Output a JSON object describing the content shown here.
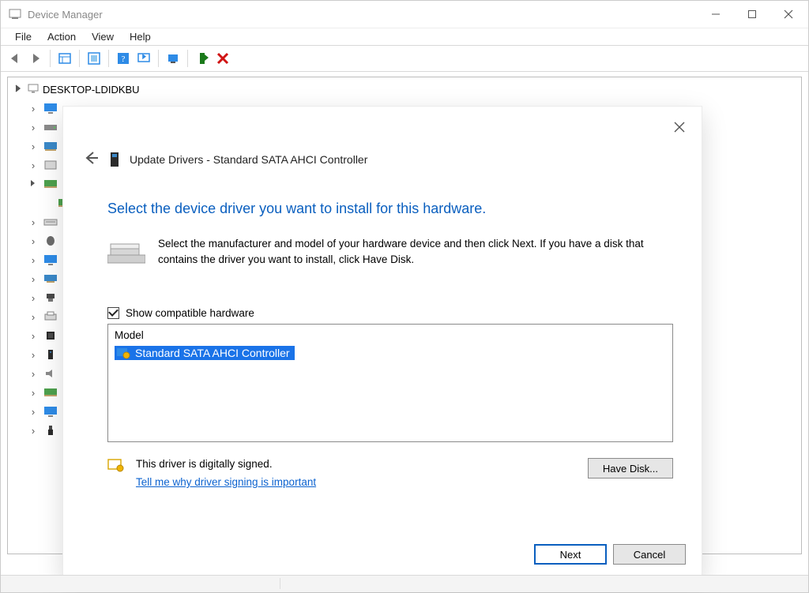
{
  "window": {
    "title": "Device Manager"
  },
  "menu": {
    "items": [
      "File",
      "Action",
      "View",
      "Help"
    ]
  },
  "tree": {
    "root_label": "DESKTOP-LDIDKBU"
  },
  "dialog": {
    "header_title": "Update Drivers - Standard SATA AHCI Controller",
    "headline": "Select the device driver you want to install for this hardware.",
    "instructions": "Select the manufacturer and model of your hardware device and then click Next. If you have a disk that contains the driver you want to install, click Have Disk.",
    "show_compatible_label": "Show compatible hardware",
    "model_column": "Model",
    "model_item": "Standard SATA AHCI Controller",
    "signed_text": "This driver is digitally signed.",
    "signing_link": "Tell me why driver signing is important",
    "have_disk_label": "Have Disk...",
    "next_label": "Next",
    "cancel_label": "Cancel"
  }
}
